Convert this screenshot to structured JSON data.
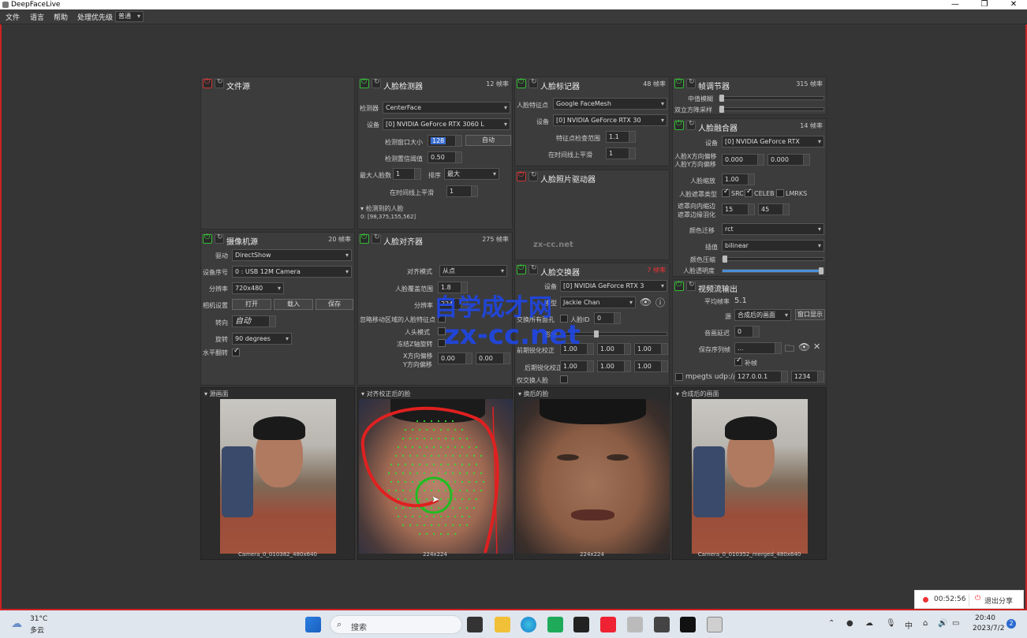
{
  "window": {
    "title": "DeepFaceLive",
    "minimize": "—",
    "maximize": "❐",
    "close": "✕"
  },
  "menu": {
    "file": "文件",
    "language": "语言",
    "help": "帮助",
    "priority_label": "处理优先级",
    "priority_value": "普通"
  },
  "file_source": {
    "title": "文件源"
  },
  "camera_source": {
    "title": "摄像机源",
    "fps": "20 帧率",
    "driver_label": "驱动",
    "driver_value": "DirectShow",
    "device_label": "设备序号",
    "device_value": "0 : USB 12M Camera",
    "resolution_label": "分辨率",
    "resolution_value": "720x480",
    "settings_label": "相机设置",
    "open": "打开",
    "load": "载入",
    "save": "保存",
    "rotation_label": "转向",
    "rotation_value": "自动",
    "rotate_label": "旋转",
    "rotate_value": "90 degrees",
    "flip_label": "水平翻转"
  },
  "face_detector": {
    "title": "人脸检测器",
    "fps": "12 帧率",
    "detector_label": "检测器",
    "detector_value": "CenterFace",
    "device_label": "设备",
    "device_value": "[0] NVIDIA GeForce RTX 3060 L",
    "window_label": "检测窗口大小",
    "window_value": "128",
    "auto": "自动",
    "threshold_label": "检测置信阈值",
    "threshold_value": "0.50",
    "max_faces_label": "最大人脸数",
    "max_faces_value": "1",
    "sort_label": "排序",
    "sort_value": "最大",
    "smooth_label": "在时间线上平滑",
    "smooth_value": "1",
    "detected_caption": "检测到的人脸",
    "detected_value": "0: [98,375,155,562]"
  },
  "face_aligner": {
    "title": "人脸对齐器",
    "fps": "275 帧率",
    "mode_label": "对齐模式",
    "mode_value": "从点",
    "coverage_label": "人脸覆盖范围",
    "coverage_value": "1.8",
    "resolution_label": "分辨率",
    "resolution_value": "224",
    "exclude_label": "忽略移动区域的人脸特征点",
    "head_mode_label": "人头模式",
    "freeze_rot_label": "冻结Z轴旋转",
    "x_offset_label": "X方向偏移",
    "y_offset_label": "Y方向偏移",
    "x_offset_value": "0.00",
    "y_offset_value": "0.00"
  },
  "face_marker": {
    "title": "人脸标记器",
    "fps": "48 帧率",
    "marker_label": "人脸特征点",
    "marker_value": "Google FaceMesh",
    "device_label": "设备",
    "device_value": "[0] NVIDIA GeForce RTX 30",
    "range_label": "特征点检查范围",
    "range_value": "1.1",
    "smooth_label": "在时间线上平滑",
    "smooth_value": "1"
  },
  "face_animator": {
    "title": "人脸照片驱动器"
  },
  "face_swapper": {
    "title": "人脸交换器",
    "fps": "7 帧率",
    "device_label": "设备",
    "device_value": "[0] NVIDIA GeForce RTX 3",
    "model_label": "模型",
    "model_value": "Jackie Chan",
    "swap_all_label": "交换所有面孔",
    "face_id_label": "人脸ID",
    "face_id_value": "0",
    "morph_label": "形变",
    "pre_sharpen_label": "前期锐化校正",
    "post_sharpen_label": "后期锐化校正",
    "v1": "1.00",
    "v2": "1.00",
    "v3": "1.00",
    "v4": "1.00",
    "v5": "1.00",
    "v6": "1.00",
    "swap_only_label": "仅交换人脸"
  },
  "frame_adjuster": {
    "title": "帧调节器",
    "fps": "315 帧率",
    "median_label": "中值模糊",
    "degrade_label": "双立方降采样"
  },
  "face_merger": {
    "title": "人脸融合器",
    "fps": "14 帧率",
    "device_label": "设备",
    "device_value": "[0] NVIDIA GeForce RTX",
    "x_offset_label": "人脸X方向偏移",
    "y_offset_label": "人脸Y方向偏移",
    "x_offset_value": "0.000",
    "y_offset_value": "0.000",
    "scale_label": "人脸缩放",
    "scale_value": "1.00",
    "mask_type_label": "人脸遮罩类型",
    "src": "SRC",
    "celeb": "CELEB",
    "lmrks": "LMRKS",
    "erode_label": "遮罩向内缩边",
    "blur_label": "遮罩边缘羽化",
    "erode_value": "15",
    "blur_value": "45",
    "color_label": "颜色迁移",
    "color_value": "rct",
    "interp_label": "插值",
    "interp_value": "bilinear",
    "compress_label": "颜色压缩",
    "opacity_label": "人脸透明度"
  },
  "stream_output": {
    "title": "视频流输出",
    "fps_label": "平均帧率",
    "fps_value": "5.1",
    "source_label": "源",
    "source_value": "合成后的画面",
    "window_btn": "窗口显示",
    "delay_label": "音画延迟",
    "delay_value": "0",
    "seq_label": "保存序列帧",
    "seq_value": "...",
    "fill_label": "补帧",
    "mpegts_label": "mpegts udp://",
    "ip_value": "127.0.0.1",
    "port_value": "1234"
  },
  "viewers": {
    "source_caption": "源画面",
    "source_footer": "Camera_0_010382_480x640",
    "aligned_caption": "对齐校正后的脸",
    "aligned_footer": "224x224",
    "swapped_caption": "换后的脸",
    "swapped_footer": "224x224",
    "merged_caption": "合成后的画面",
    "merged_footer": "Camera_0_010352_merged_480x640"
  },
  "watermarks": {
    "w1": "zx-cc.net",
    "w2": "自学成才网",
    "w3": "zx-cc.net"
  },
  "recording": {
    "time": "00:52:56",
    "stop": "退出分享"
  },
  "taskbar": {
    "temp": "31°C",
    "weather": "多云",
    "search": "搜索",
    "time": "20:40",
    "date": "2023/7/2",
    "ime": "中",
    "notif": "2"
  },
  "colors": {
    "accent": "#4a8fd8",
    "power_on": "#44cc44",
    "power_off": "#ee4444",
    "record": "#e33333"
  }
}
